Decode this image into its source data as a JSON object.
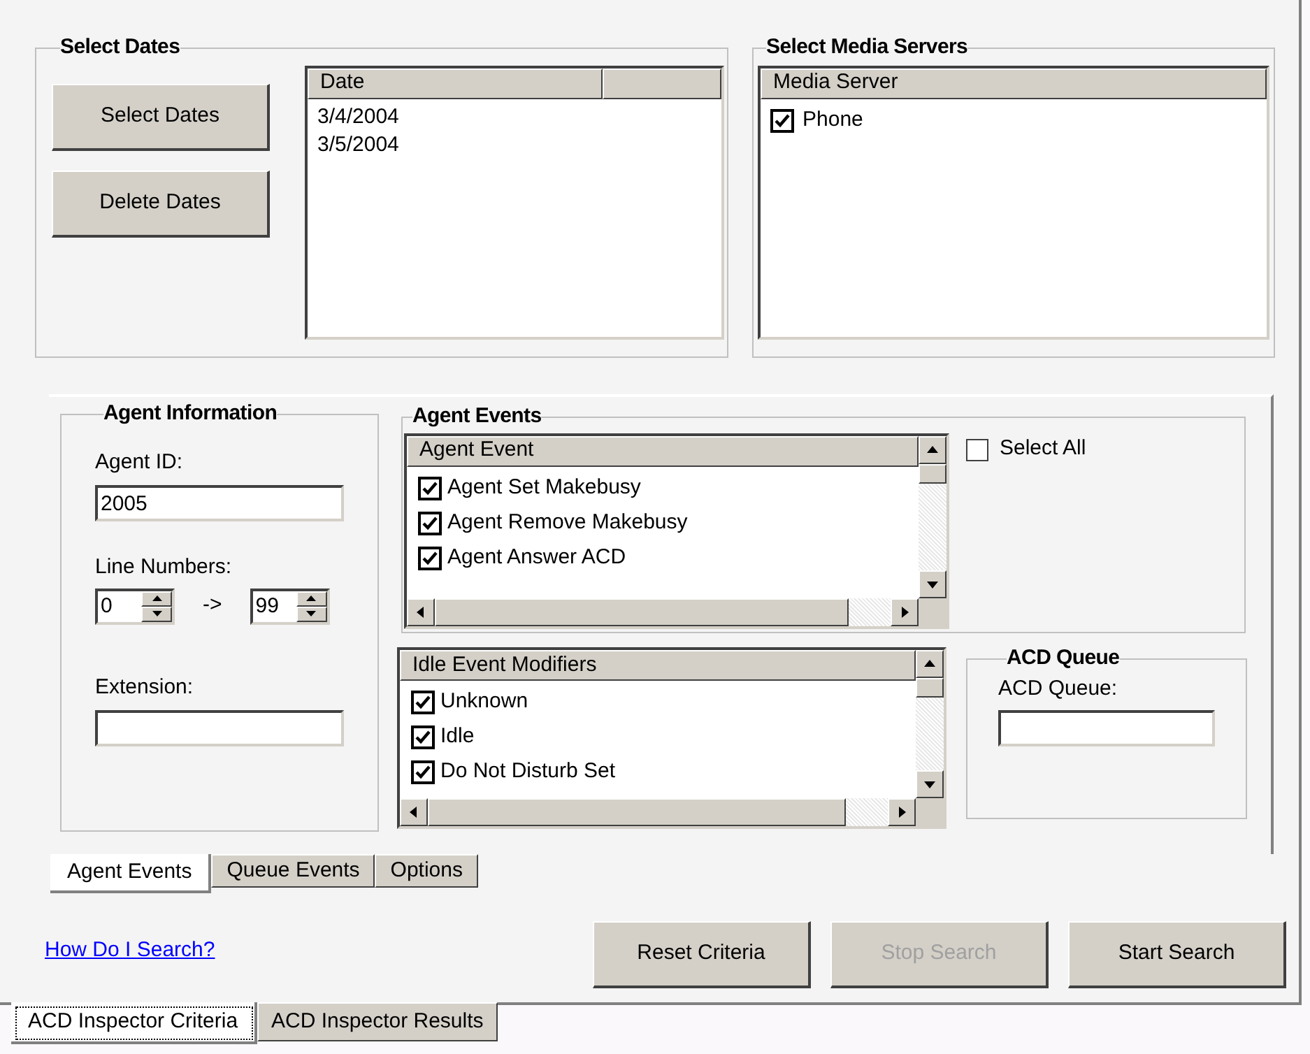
{
  "date_panel": {
    "title": "Select Dates",
    "buttons": [
      "Select Dates",
      "Delete Dates"
    ],
    "column": "Date",
    "rows": [
      "3/4/2004",
      "3/5/2004"
    ]
  },
  "media_panel": {
    "title": "Select Media Servers",
    "column": "Media Server",
    "items": [
      {
        "label": "Phone",
        "checked": true
      }
    ]
  },
  "agent_info": {
    "title": "Agent Information",
    "agent_id_label": "Agent ID:",
    "agent_id": "2005",
    "line_numbers_label": "Line Numbers:",
    "line_from": "0",
    "arrow": "->",
    "line_to": "99",
    "extension_label": "Extension:"
  },
  "agent_events": {
    "title": "Agent Events",
    "column": "Agent Event",
    "items": [
      {
        "label": "Agent Set Makebusy",
        "checked": true
      },
      {
        "label": "Agent Remove Makebusy",
        "checked": true
      },
      {
        "label": "Agent Answer ACD",
        "checked": true
      }
    ],
    "select_all": {
      "label": "Select All",
      "checked": false
    }
  },
  "idle_modifiers": {
    "column": "Idle Event Modifiers",
    "items": [
      {
        "label": "Unknown",
        "checked": true
      },
      {
        "label": "Idle",
        "checked": true
      },
      {
        "label": "Do Not Disturb Set",
        "checked": true
      }
    ]
  },
  "acd_queue": {
    "title": "ACD Queue",
    "label": "ACD Queue:"
  },
  "inner_tabs": [
    {
      "label": "Agent Events",
      "selected": true
    },
    {
      "label": "Queue Events",
      "selected": false
    },
    {
      "label": "Options",
      "selected": false
    }
  ],
  "help_link": "How Do I Search?",
  "actions": [
    {
      "label": "Reset Criteria",
      "disabled": false
    },
    {
      "label": "Stop Search",
      "disabled": true
    },
    {
      "label": "Start Search",
      "disabled": false
    }
  ],
  "outer_tabs": [
    {
      "label": "ACD Inspector Criteria",
      "selected": true
    },
    {
      "label": "ACD Inspector Results",
      "selected": false
    }
  ]
}
